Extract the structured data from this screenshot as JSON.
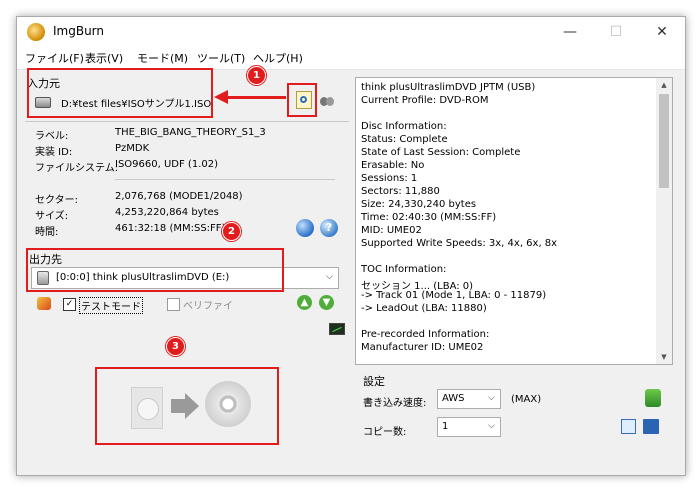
{
  "window": {
    "title": "ImgBurn",
    "minimize": "—",
    "maximize": "☐",
    "close": "✕"
  },
  "menu": {
    "items": [
      "ファイル(F)",
      "表示(V)",
      "モード(M)",
      "ツール(T)",
      "ヘルプ(H)"
    ]
  },
  "source": {
    "label": "入力元",
    "path": "D:¥test files¥ISOサンプル1.ISO"
  },
  "disc_info": {
    "rows": [
      {
        "key": "ラベル:",
        "value": "THE_BIG_BANG_THEORY_S1_3"
      },
      {
        "key": "実装 ID:",
        "value": "PzMDK"
      },
      {
        "key": "ファイルシステム:",
        "value": "ISO9660, UDF (1.02)"
      },
      {
        "key": "セクター:",
        "value": "2,076,768 (MODE1/2048)"
      },
      {
        "key": "サイズ:",
        "value": "4,253,220,864 bytes"
      },
      {
        "key": "時間:",
        "value": "461:32:18 (MM:SS:FF)"
      }
    ]
  },
  "destination": {
    "label": "出力先",
    "drive": "[0:0:0] think plusUltraslimDVD (E:)",
    "test_mode_label": "テストモード",
    "test_mode_checked": true,
    "verify_label": "ベリファイ",
    "verify_checked": false
  },
  "info_panel": {
    "lines": [
      "think plusUltraslimDVD JPTM (USB)",
      "Current Profile: DVD-ROM",
      "",
      "Disc Information:",
      "Status: Complete",
      "State of Last Session: Complete",
      "Erasable: No",
      "Sessions: 1",
      "Sectors: 11,880",
      "Size: 24,330,240 bytes",
      "Time: 02:40:30 (MM:SS:FF)",
      "MID: UME02",
      "Supported Write Speeds: 3x, 4x, 6x, 8x",
      "",
      "TOC Information:",
      "セッション 1... (LBA: 0)",
      "-> Track 01  (Mode 1, LBA: 0 - 11879)",
      "-> LeadOut  (LBA: 11880)",
      "",
      "Pre-recorded Information:",
      "Manufacturer ID: UME02"
    ]
  },
  "settings": {
    "label": "設定",
    "speed_label": "書き込み速度:",
    "speed_value": "AWS",
    "speed_max": "(MAX)",
    "copies_label": "コピー数:",
    "copies_value": "1"
  },
  "annotations": {
    "badge1": "1",
    "badge2": "2",
    "badge3": "3",
    "accent_color": "#e21c1c"
  }
}
